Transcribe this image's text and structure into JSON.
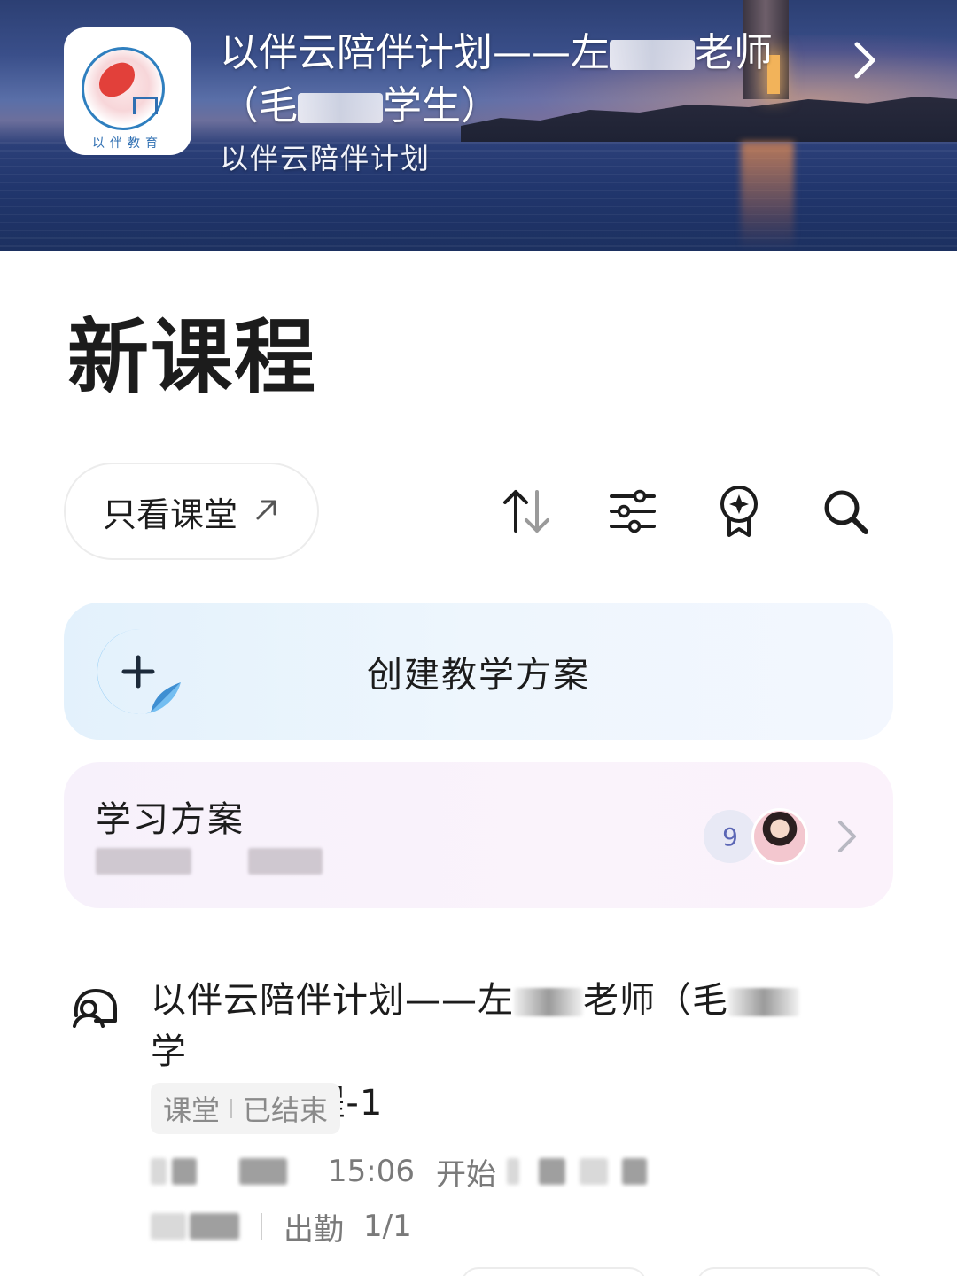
{
  "header": {
    "title_part1": "以伴云陪伴计划——左",
    "title_part2": "老师",
    "title_part3": "（毛",
    "title_part4": "学生）",
    "subtitle": "以伴云陪伴计划",
    "logo_caption": "以伴教育"
  },
  "page": {
    "title": "新课程"
  },
  "toolbar": {
    "filter_label": "只看课堂",
    "icons": [
      "sort-icon",
      "filter-sliders-icon",
      "award-badge-icon",
      "search-icon"
    ]
  },
  "create_card": {
    "label": "创建教学方案"
  },
  "plan_card": {
    "title": "学习方案",
    "member_count": "9"
  },
  "course": {
    "title_part1": "以伴云陪伴计划——左",
    "title_part2": "老师（毛",
    "title_part3": "学",
    "title_part4": "生）-新课程-1",
    "tag_type": "课堂",
    "tag_status": "已结束",
    "start_time": "15:06",
    "start_label": "开始",
    "attendance_label": "出勤",
    "attendance_value": "1/1"
  },
  "colors": {
    "accent_blue": "#5b9fd8",
    "create_card_bg": "#e8f3fc",
    "plan_card_bg": "#f8f2fb",
    "badge_text": "#5b66b5"
  }
}
